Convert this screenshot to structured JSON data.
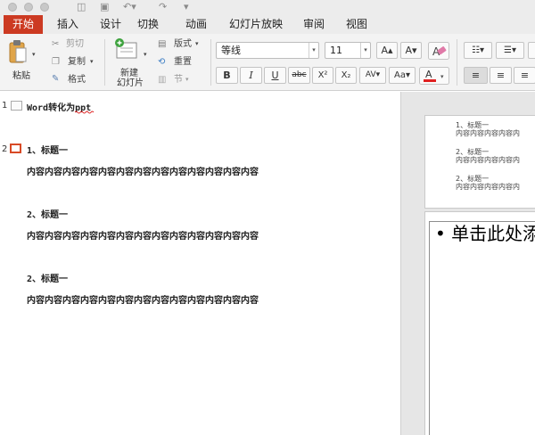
{
  "ribbon_tabs": [
    "开始",
    "插入",
    "设计",
    "切换",
    "动画",
    "幻灯片放映",
    "审阅",
    "视图"
  ],
  "active_tab": "开始",
  "ribbon": {
    "paste": "粘贴",
    "cut": "剪切",
    "copy": "复制",
    "format": "格式",
    "new_slide_1": "新建",
    "new_slide_2": "幻灯片",
    "layout": "版式",
    "reset": "重置",
    "section": "节",
    "font_name": "等线",
    "font_size": "11",
    "bold": "B",
    "italic": "I",
    "underline": "U",
    "strike": "abc",
    "superscript": "X²",
    "subscript": "X₂"
  },
  "outline": {
    "slides": [
      {
        "number": "1",
        "title": "Word转化为ppt"
      },
      {
        "number": "2",
        "lines": [
          "1、标题一",
          "内容内容内容内容内容内容内容内容内容内容内容内容内容",
          "2、标题一",
          "内容内容内容内容内容内容内容内容内容内容内容内容内容",
          "2、标题一",
          "内容内容内容内容内容内容内容内容内容内容内容内容内容"
        ]
      }
    ]
  },
  "preview": {
    "thumb_lines": [
      "1、标题一",
      "内容内容内容内容内",
      "2、标题一",
      "内容内容内容内容内",
      "2、标题一",
      "内容内容内容内容内"
    ],
    "placeholder_text": "• 单击此处添加文本"
  }
}
